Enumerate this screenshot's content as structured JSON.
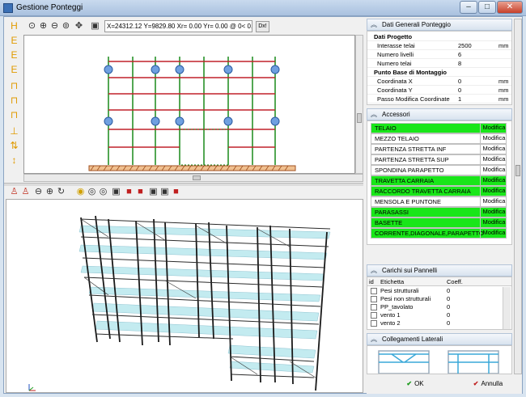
{
  "window": {
    "title": "Gestione Ponteggi",
    "controls": [
      "–",
      "□",
      "✕"
    ]
  },
  "toolbar2d": {
    "coords": "X=24312.12 Y=9829.80 Xr= 0.00 Yr= 0.00 @ 0< 0.00",
    "dx_label": "Dx!"
  },
  "left_tools": [
    "H",
    "E",
    "E",
    "E",
    "⊓",
    "⊓",
    "⊓",
    "⊥",
    "⇅",
    "↕"
  ],
  "sections": {
    "dati": {
      "header": "Dati Generali Ponteggio",
      "rows": [
        {
          "key": "Dati Progetto",
          "value": "",
          "unit": "",
          "group": true
        },
        {
          "key": "Interasse telai",
          "value": "2500",
          "unit": "mm"
        },
        {
          "key": "Numero livelli",
          "value": "6",
          "unit": ""
        },
        {
          "key": "Numero telai",
          "value": "8",
          "unit": ""
        },
        {
          "key": "Punto Base di Montaggio",
          "value": "",
          "unit": "",
          "group": true
        },
        {
          "key": "Coordinata X",
          "value": "0",
          "unit": "mm"
        },
        {
          "key": "Coordinata Y",
          "value": "0",
          "unit": "mm"
        },
        {
          "key": "Passo Modifica Coordinate",
          "value": "1",
          "unit": "mm"
        }
      ]
    },
    "accessori": {
      "header": "Accessori",
      "modify_label": "Modifica",
      "rows": [
        {
          "name": "TELAIO",
          "active": true
        },
        {
          "name": "MEZZO TELAIO",
          "active": false
        },
        {
          "name": "PARTENZA STRETTA INF",
          "active": false
        },
        {
          "name": "PARTENZA STRETTA SUP",
          "active": false
        },
        {
          "name": "SPONDINA PARAPETTO",
          "active": false
        },
        {
          "name": "TRAVETTA CARRAIA",
          "active": true
        },
        {
          "name": "RACCORDO TRAVETTA CARRAIA",
          "active": true
        },
        {
          "name": "MENSOLA E PUNTONE",
          "active": false
        },
        {
          "name": "PARASASSI",
          "active": true
        },
        {
          "name": "BASETTE",
          "active": true
        },
        {
          "name": "CORRENTE,DIAGONALE,PARAPETTO",
          "active": true
        }
      ]
    },
    "carichi": {
      "header": "Carichi sui Pannelli",
      "columns": [
        "id",
        "Etichetta",
        "Coeff."
      ],
      "rows": [
        {
          "label": "Pesi strutturali",
          "coeff": "0"
        },
        {
          "label": "Pesi non strutturali",
          "coeff": "0"
        },
        {
          "label": "PP_tavolato",
          "coeff": "0"
        },
        {
          "label": "vento 1",
          "coeff": "0"
        },
        {
          "label": "vento 2",
          "coeff": "0"
        }
      ]
    },
    "collegamenti": {
      "header": "Collegamenti Laterali"
    }
  },
  "buttons": {
    "ok": "OK",
    "cancel": "Annulla"
  },
  "colors": {
    "active_row": "#19e619",
    "frame_red": "#c0202a",
    "frame_green": "#1a8a1a",
    "node_blue": "#6fa0e0"
  }
}
